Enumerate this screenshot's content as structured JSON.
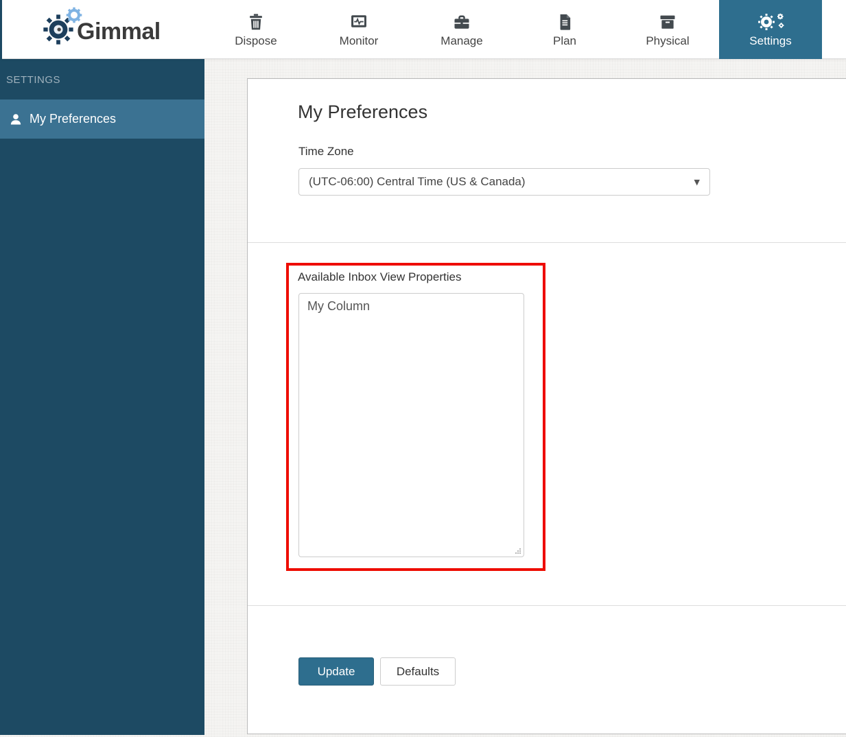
{
  "brand": {
    "name": "Gimmal"
  },
  "header": {
    "nav_items": [
      {
        "label": "Dispose",
        "icon": "trash-icon",
        "active": false
      },
      {
        "label": "Monitor",
        "icon": "monitor-icon",
        "active": false
      },
      {
        "label": "Manage",
        "icon": "briefcase-icon",
        "active": false
      },
      {
        "label": "Plan",
        "icon": "document-icon",
        "active": false
      },
      {
        "label": "Physical",
        "icon": "archive-box-icon",
        "active": false
      },
      {
        "label": "Settings",
        "icon": "gears-icon",
        "active": true
      }
    ]
  },
  "sidebar": {
    "section_label": "SETTINGS",
    "items": [
      {
        "label": "My Preferences",
        "icon": "person-icon",
        "active": true
      }
    ]
  },
  "main": {
    "title": "My Preferences",
    "timezone_label": "Time Zone",
    "timezone_value": "(UTC-06:00) Central Time (US & Canada)",
    "inbox_props_label": "Available Inbox View Properties",
    "inbox_props_items": [
      "My Column"
    ],
    "update_label": "Update",
    "defaults_label": "Defaults"
  },
  "annotation": {
    "color": "#ee0c00"
  },
  "colors": {
    "accent_teal": "#2e6e8e",
    "sidebar_dark": "#1d4a63",
    "sidebar_selected": "#3b7292",
    "icon_gray": "#434a4f",
    "card_border": "#b9b9b9"
  }
}
